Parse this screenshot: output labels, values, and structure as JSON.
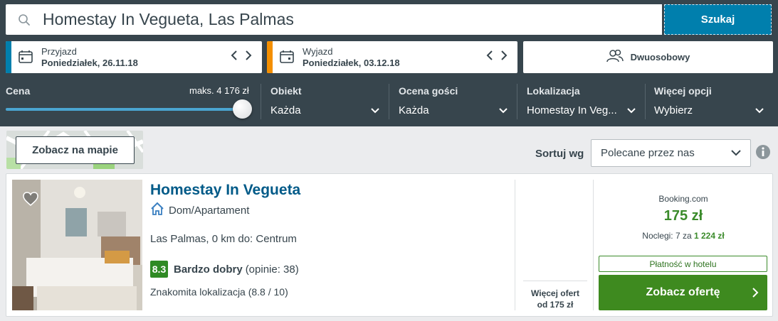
{
  "search": {
    "query": "Homestay In Vegueta, Las Palmas",
    "button_label": "Szukaj"
  },
  "checkin": {
    "label": "Przyjazd",
    "date": "Poniedziałek, 26.11.18",
    "accent": "#007fad"
  },
  "checkout": {
    "label": "Wyjazd",
    "date": "Poniedziałek, 03.12.18",
    "accent": "#f48f00"
  },
  "room": {
    "label": "Dwuosobowy"
  },
  "filters": {
    "price": {
      "label": "Cena",
      "max_label": "maks. 4 176 zł",
      "slider_fraction": 1.0
    },
    "property": {
      "label": "Obiekt",
      "value": "Każda"
    },
    "guest_rating": {
      "label": "Ocena gości",
      "value": "Każda"
    },
    "location": {
      "label": "Lokalizacja",
      "value": "Homestay In Veg..."
    },
    "more": {
      "label": "Więcej opcji",
      "value": "Wybierz"
    }
  },
  "map": {
    "button_label": "Zobacz na mapie"
  },
  "sort": {
    "label": "Sortuj wg",
    "value": "Polecane przez nas"
  },
  "result": {
    "name": "Homestay In Vegueta",
    "type": "Dom/Apartament",
    "location": "Las Palmas, 0 km do: Centrum",
    "rating_score": "8.3",
    "rating_text": "Bardzo dobry",
    "rating_count": "(opinie: 38)",
    "highlight": "Znakomita lokalizacja (8.8 / 10)",
    "more_offers_line1": "Więcej ofert",
    "more_offers_line2": "od 175 zł",
    "provider": "Booking.com",
    "price": "175 zł",
    "nights_prefix": "Noclegi: 7 za",
    "nights_total": "1 224 zł",
    "payment_note": "Płatność w hotelu",
    "deal_button": "Zobacz ofertę"
  },
  "colors": {
    "header_bg": "#37454d",
    "accent_blue": "#007fad",
    "deal_green": "#3e8a1f",
    "rating_green": "#2f8a24"
  }
}
